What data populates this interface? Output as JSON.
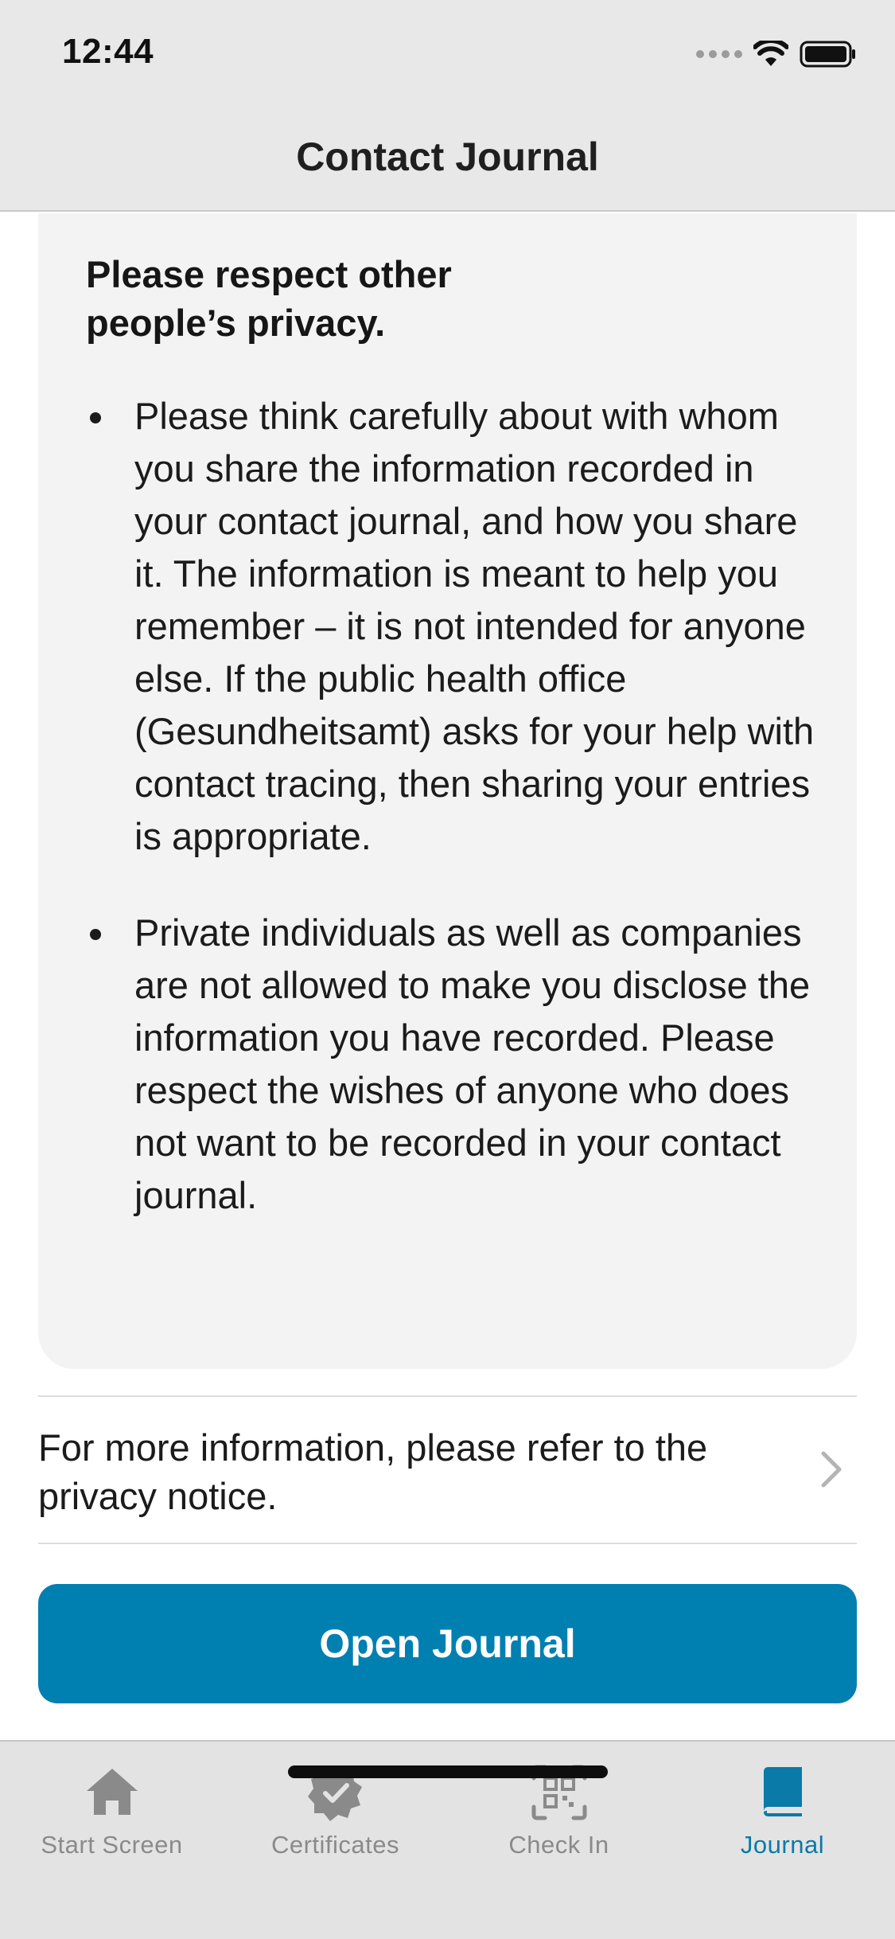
{
  "status_bar": {
    "time": "12:44"
  },
  "nav": {
    "title": "Contact Journal"
  },
  "card": {
    "heading": "Please respect other people’s privacy.",
    "bullets": [
      "Please think carefully about with whom you share the information recorded in your contact journal, and how you share it. The information is meant to help you remember – it is not intended for anyone else. If the public health office (Gesundheitsamt) asks for your help with contact tracing, then sharing your entries is appropriate.",
      "Private individuals as well as companies are not allowed to make you disclose the information you have recorded. Please respect the wishes of anyone who does not want to be recorded in your contact journal."
    ]
  },
  "privacy_link": {
    "text": "For more information, please refer to the privacy notice.",
    "icon": "chevron-right-icon"
  },
  "primary_button": {
    "label": "Open Journal"
  },
  "tab_bar": {
    "active_color": "#0a7aa8",
    "inactive_color": "#8a8a8a",
    "tabs": [
      {
        "label": "Start Screen",
        "icon": "home-icon",
        "active": false
      },
      {
        "label": "Certificates",
        "icon": "certificate-badge-icon",
        "active": false
      },
      {
        "label": "Check In",
        "icon": "qr-code-icon",
        "active": false
      },
      {
        "label": "Journal",
        "icon": "book-icon",
        "active": true
      }
    ]
  },
  "colors": {
    "accent": "#0080b0",
    "card_background": "#f3f3f3"
  }
}
